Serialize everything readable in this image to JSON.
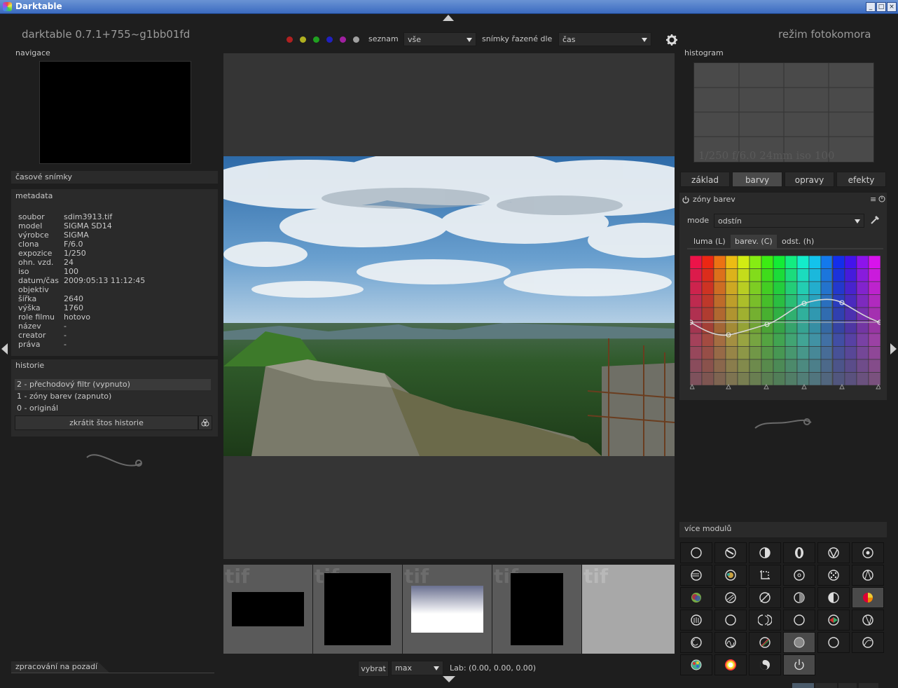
{
  "window": {
    "title": "Darktable",
    "buttons": [
      "_",
      "□",
      "×"
    ]
  },
  "header": {
    "version": "darktable 0.7.1+755~g1bb01fd",
    "mode": "režim fotokomora",
    "color_labels": [
      "#b02020",
      "#b0b020",
      "#20a020",
      "#2020c0",
      "#a020a0",
      "#a0a0a0"
    ],
    "list_label": "seznam",
    "list_value": "vše",
    "sort_label": "snímky řazené dle",
    "sort_value": "čas"
  },
  "left": {
    "navigation": "navigace",
    "timeline": "časové snímky",
    "metadata_title": "metadata",
    "metadata": [
      {
        "k": "soubor",
        "v": "sdim3913.tif"
      },
      {
        "k": "model",
        "v": "SIGMA SD14"
      },
      {
        "k": "výrobce",
        "v": "SIGMA"
      },
      {
        "k": "clona",
        "v": "F/6.0"
      },
      {
        "k": "expozice",
        "v": "1/250"
      },
      {
        "k": "ohn. vzd.",
        "v": "24"
      },
      {
        "k": "iso",
        "v": "100"
      },
      {
        "k": "datum/čas",
        "v": "2009:05:13 11:12:45"
      },
      {
        "k": "objektiv",
        "v": ""
      },
      {
        "k": "šířka",
        "v": "2640"
      },
      {
        "k": "výška",
        "v": "1760"
      },
      {
        "k": "role filmu",
        "v": "hotovo"
      },
      {
        "k": "název",
        "v": "-"
      },
      {
        "k": "creator",
        "v": "-"
      },
      {
        "k": "práva",
        "v": "-"
      }
    ],
    "history_title": "historie",
    "history": [
      "2 - přechodový filtr (vypnuto)",
      "1 - zóny barev (zapnuto)",
      "0 - originál"
    ],
    "compress_button": "zkrátit štos historie",
    "background_jobs": "zpracování na pozadí"
  },
  "filmstrip": {
    "thumb_label": "tif"
  },
  "bottom": {
    "select_label": "vybrat",
    "select_value": "max",
    "lab_readout": "Lab: (0.00, 0.00, 0.00)"
  },
  "right": {
    "histogram_title": "histogram",
    "histogram_info": "1/250 f/6.0 24mm iso 100",
    "group_tabs": [
      "základ",
      "barvy",
      "opravy",
      "efekty"
    ],
    "module_title": "zóny barev",
    "mode_label": "mode",
    "mode_value": "odstín",
    "channel_tabs": [
      "luma (L)",
      "barev. (C)",
      "odst. (h)"
    ],
    "more_modules": "více modulů",
    "module_icons": [
      "circle-icon",
      "exposure-icon",
      "tone-icon",
      "contrast-icon",
      "vignette-icon",
      "target-icon",
      "demosaic-icon",
      "color-wheel-icon",
      "crop-icon",
      "lens-icon",
      "dots-icon",
      "sharpen-icon",
      "rgb-icon",
      "grain-icon",
      "no-icon",
      "split-icon",
      "half-icon",
      "colorzones-icon",
      "hand-icon",
      "ring-icon",
      "spiral-icon",
      "plain-circle-icon",
      "mixer-icon",
      "tag-icon",
      "swirl-icon",
      "waves-icon",
      "slash-icon",
      "gray-ball-icon",
      "outline-circle-icon",
      "curve-icon",
      "palette-icon",
      "rainbow-icon",
      "yinyang-icon",
      "power-icon"
    ]
  }
}
